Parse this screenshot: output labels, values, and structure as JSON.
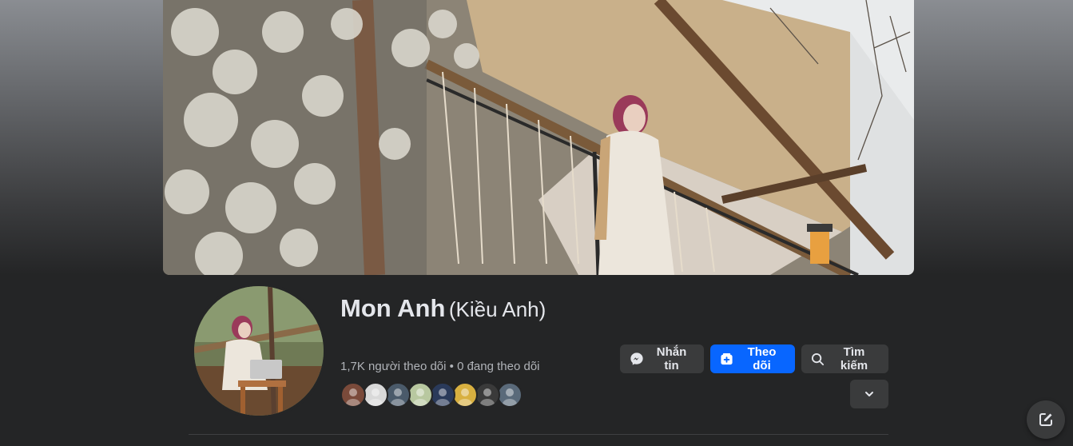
{
  "profile": {
    "name": "Mon Anh",
    "alternate_name": "(Kiều Anh)",
    "followers_text": "1,7K người theo dõi",
    "separator": " • ",
    "following_text": "0 đang theo dõi"
  },
  "actions": {
    "message_label": "Nhắn tin",
    "follow_label": "Theo dõi",
    "search_label": "Tìm kiếm"
  },
  "followers_preview": [
    {
      "name": "follower-avatar-1",
      "color": "#7a4a3a"
    },
    {
      "name": "follower-avatar-2",
      "color": "#d9d9d9"
    },
    {
      "name": "follower-avatar-3",
      "color": "#4a5a6a"
    },
    {
      "name": "follower-avatar-4",
      "color": "#b8c8a0"
    },
    {
      "name": "follower-avatar-5",
      "color": "#2a3a5a"
    },
    {
      "name": "follower-avatar-6",
      "color": "#d8b040"
    },
    {
      "name": "follower-avatar-7",
      "color": "#3a3a3a"
    },
    {
      "name": "follower-avatar-8",
      "color": "#5a6a7a"
    }
  ],
  "colors": {
    "primary": "#0866ff",
    "background": "#242526",
    "secondary_button": "#3a3b3c",
    "text": "#e4e6eb",
    "muted_text": "#b0b3b8"
  }
}
